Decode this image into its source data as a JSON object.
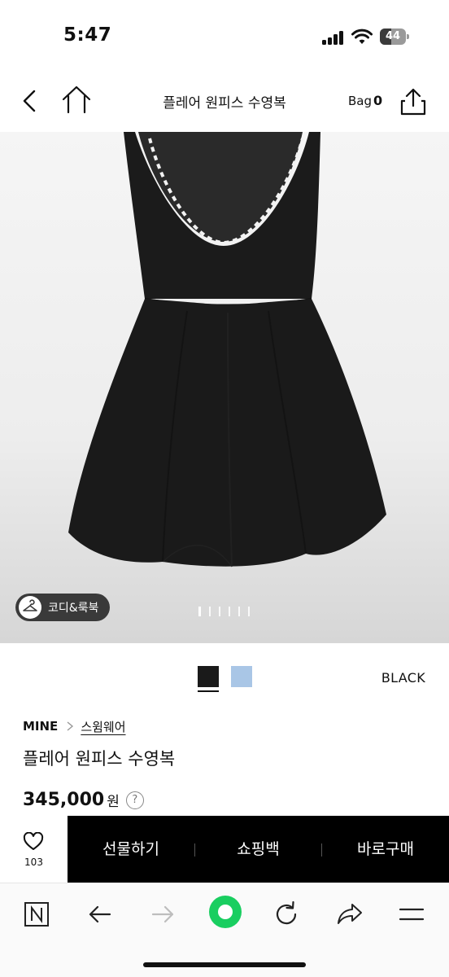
{
  "status_bar": {
    "time": "5:47",
    "battery_level": "44"
  },
  "header": {
    "title": "플레어 원피스 수영복",
    "bag_label": "Bag",
    "bag_count": "0"
  },
  "hero": {
    "look_label": "코디&룩북",
    "image_count": 6,
    "active_index": 1
  },
  "colors": {
    "selected_name": "BLACK",
    "swatches": [
      "#1a1a1a",
      "#a9c6e6"
    ]
  },
  "product": {
    "brand": "MINE",
    "category": "스윔웨어",
    "title": "플레어 원피스 수영복",
    "price": "345,000",
    "price_unit": "원",
    "help_glyph": "?"
  },
  "actions": {
    "like_count": "103",
    "gift_label": "선물하기",
    "cart_label": "쇼핑백",
    "buy_label": "바로구매"
  }
}
